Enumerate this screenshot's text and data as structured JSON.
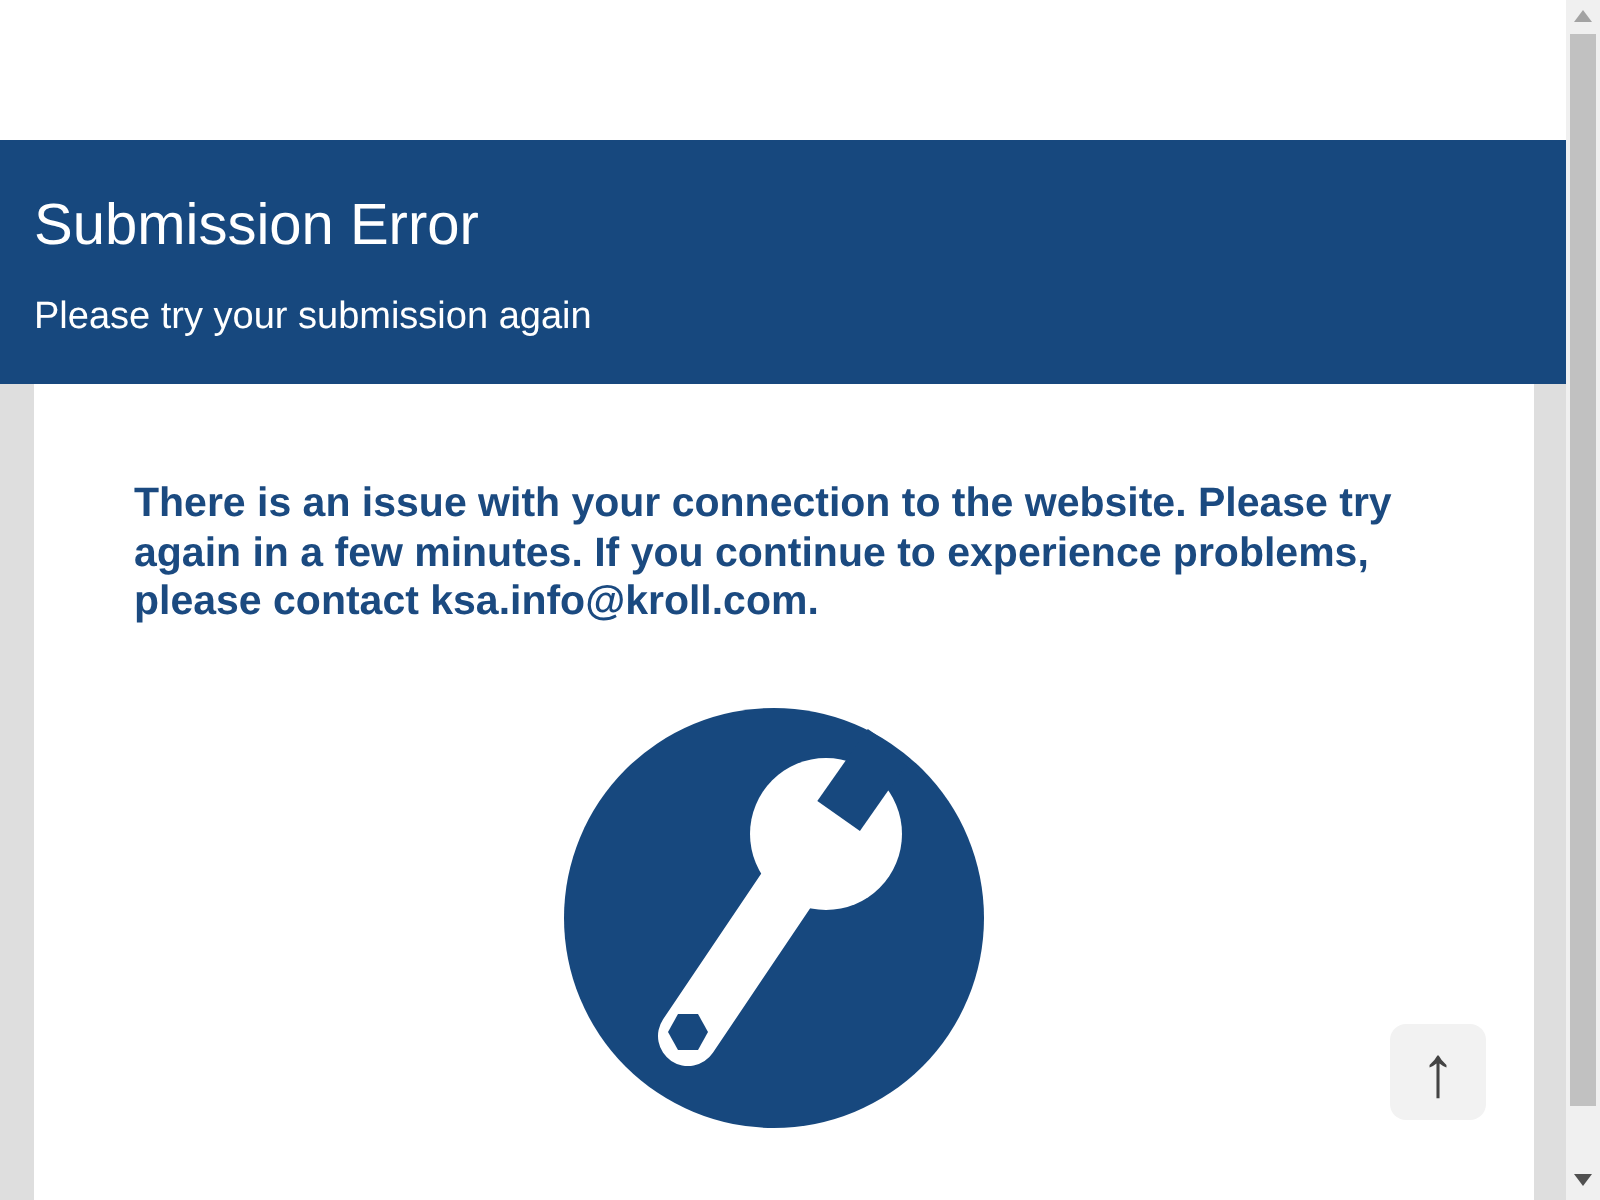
{
  "header": {
    "title": "Submission Error",
    "subtitle": "Please try your submission again"
  },
  "message": "There is an issue with your connection to the website. Please try again in a few minutes. If you continue to experience problems, please contact ksa.info@kroll.com.",
  "back_to_top": {
    "label": "↑"
  }
}
